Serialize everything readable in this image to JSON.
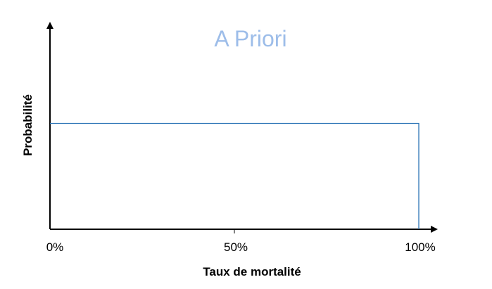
{
  "chart_data": {
    "type": "line",
    "title": "A Priori",
    "xlabel": "Taux de mortalité",
    "ylabel": "Probabilité",
    "x_ticks": [
      {
        "value": 0,
        "label": "0%"
      },
      {
        "value": 50,
        "label": "50%"
      },
      {
        "value": 100,
        "label": "100%"
      }
    ],
    "xlim": [
      0,
      100
    ],
    "ylim": [
      0,
      1
    ],
    "grid": false,
    "series": [
      {
        "x": [
          0,
          100,
          100
        ],
        "y": [
          0.5,
          0.5,
          0
        ],
        "color": "#2e75b6"
      }
    ],
    "colors": {
      "title": "#9dbde9",
      "axis": "#000000",
      "line": "#2e75b6"
    }
  }
}
